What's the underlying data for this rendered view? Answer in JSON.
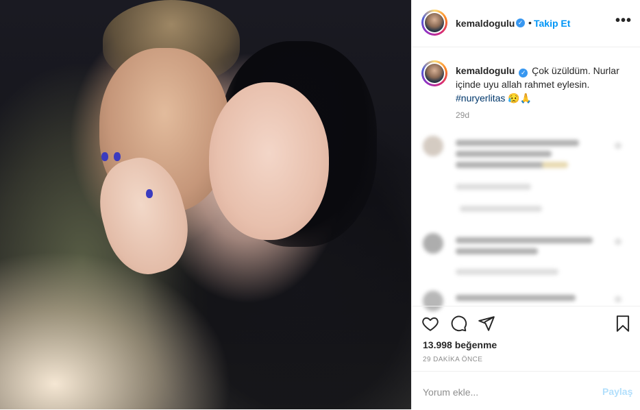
{
  "post": {
    "username": "kemaldogulu",
    "verified_icon": "verified-badge-icon",
    "follow_label": "Takip Et",
    "separator": "•",
    "more_label": "•••",
    "caption_username": "kemaldogulu",
    "caption_text": "Çok üzüldüm. Nurlar içinde uyu allah rahmet eylesin.",
    "caption_hashtag": "#nuryerlitas",
    "caption_emoji": "😥🙏",
    "caption_age": "29d",
    "likes": "13.998 beğenme",
    "time_ago": "29 DAKİKA ÖNCE"
  },
  "actions": {
    "like_icon": "heart-icon",
    "comment_icon": "comment-bubble-icon",
    "share_icon": "paper-plane-icon",
    "save_icon": "bookmark-icon"
  },
  "comment_box": {
    "placeholder": "Yorum ekle...",
    "post_label": "Paylaş"
  },
  "colors": {
    "accent": "#0095f6",
    "verified": "#3897f0",
    "hashtag": "#00376b",
    "post_disabled": "#b2dffc",
    "muted": "#8e8e8e"
  }
}
